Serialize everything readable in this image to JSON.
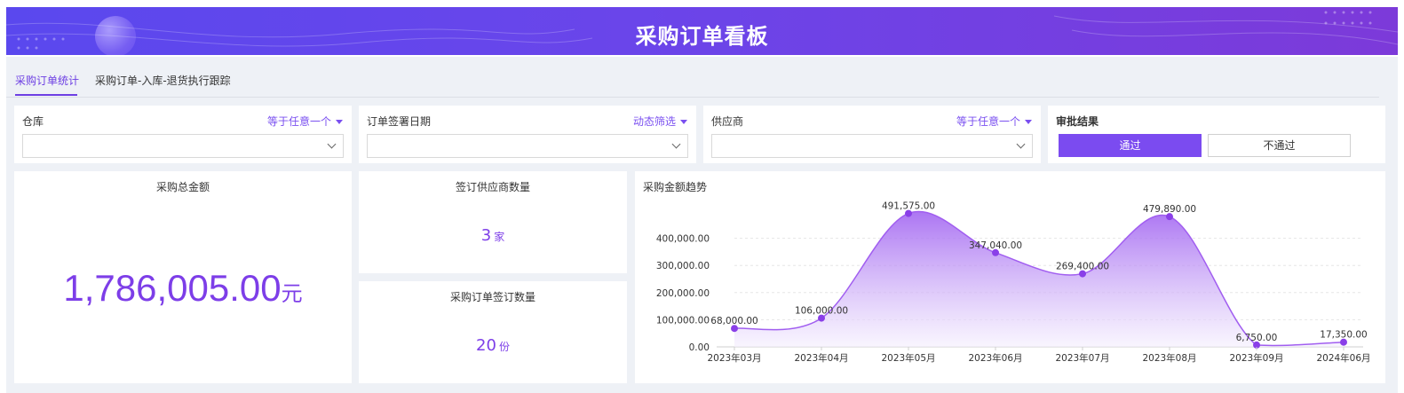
{
  "header": {
    "title": "采购订单看板"
  },
  "tabs": [
    {
      "label": "采购订单统计",
      "active": true
    },
    {
      "label": "采购订单-入库-退货执行跟踪",
      "active": false
    }
  ],
  "filters": {
    "warehouse": {
      "label": "仓库",
      "mode": "等于任意一个",
      "value": ""
    },
    "sign_date": {
      "label": "订单签署日期",
      "mode": "动态筛选",
      "value": ""
    },
    "supplier": {
      "label": "供应商",
      "mode": "等于任意一个",
      "value": ""
    },
    "approval": {
      "label": "审批结果",
      "options": [
        "通过",
        "不通过"
      ],
      "selected": "通过"
    }
  },
  "kpis": {
    "total_amount": {
      "title": "采购总金额",
      "value": "1,786,005.00",
      "unit": "元"
    },
    "supplier_count": {
      "title": "签订供应商数量",
      "value": "3",
      "unit": "家"
    },
    "order_count": {
      "title": "采购订单签订数量",
      "value": "20",
      "unit": "份"
    }
  },
  "chart_data": {
    "type": "area",
    "title": "采购金额趋势",
    "categories": [
      "2023年03月",
      "2023年04月",
      "2023年05月",
      "2023年06月",
      "2023年07月",
      "2023年08月",
      "2023年09月",
      "2024年06月"
    ],
    "values": [
      68000,
      106000,
      491575,
      347040,
      269400,
      479890,
      6750,
      17350
    ],
    "value_labels": [
      "68,000.00",
      "106,000.00",
      "491,575.00",
      "347,040.00",
      "269,400.00",
      "479,890.00",
      "6,750.00",
      "17,350.00"
    ],
    "ylim": [
      0,
      500000
    ],
    "yticks": [
      0,
      100000,
      200000,
      300000,
      400000
    ],
    "ytick_labels": [
      "0.00",
      "100,000.00",
      "200,000.00",
      "300,000.00",
      "400,000.00"
    ],
    "grid": true,
    "colors": {
      "line": "#a15ef0",
      "point": "#8a3fe8",
      "fill_top": "#9d5df0",
      "fill_bottom": "#f4eefe"
    }
  },
  "colors": {
    "accent": "#7b4bf0",
    "banner_start": "#5a48ee",
    "banner_end": "#7c3ad9"
  }
}
